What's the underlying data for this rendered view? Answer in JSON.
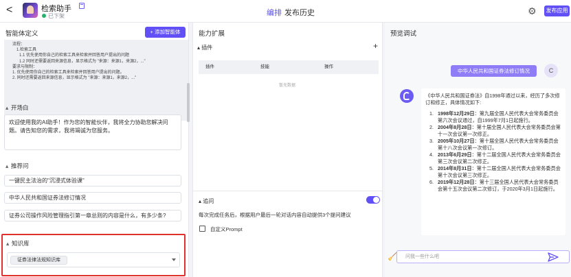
{
  "header": {
    "back_glyph": "<",
    "app_name": "检索助手",
    "status": "已下架",
    "tabs": [
      {
        "label": "编排"
      },
      {
        "label": "发布历史"
      }
    ],
    "publish_label": "发布应用"
  },
  "agent_panel": {
    "title": "智能体定义",
    "add_agent_label": "+ 添加智能体",
    "definition_lines": [
      "流程：",
      "  1.检索工具",
      "    1.1 优先使用你自己的检索工具来检索并回答用户提出的问题",
      "    1.2 同时还需要返回来源信息，显示格式为 \"来源：来源1，来源2，...\"",
      "要求与限制：",
      "  1. 优先使用你自己的检索工具来检索并回答用户提出的问题。",
      "  2. 同时还需要返回来源信息，显示格式为 \"来源：来源1，来源2，...\""
    ],
    "opening": {
      "title": "开场白",
      "text": "欢迎使用我的AI助手！作为您的智能伙伴，我将全力协助您解决问题。请告知您的需求，我将竭诚为您服务。"
    },
    "suggested": {
      "title": "推荐问",
      "items": [
        "一键民主法治的\"沉浸式体验课\"",
        "中华人民共和国证券法修订情况",
        "证券公司操作风险管理指引第一章总则的内容是什么，有多少条?"
      ]
    },
    "knowledge": {
      "title": "知识库",
      "tag": "证券法律法规知识库"
    }
  },
  "ability_panel": {
    "title": "能力扩展",
    "plugin": {
      "title": "插件",
      "add_glyph": "+",
      "columns": [
        "插件",
        "技能",
        "操作"
      ],
      "empty": "暂无数据"
    },
    "followup": {
      "title": "追问",
      "enabled": true,
      "desc": "每次完成任务后，根据用户最后一轮对话内容自动提供3个提问建议",
      "custom_prompt_label": "自定义Prompt"
    }
  },
  "preview_panel": {
    "title": "预览调试",
    "user_message": "中华人民共和国证券法修订情况",
    "user_avatar": "C",
    "bot_intro": "《中华人民共和国证券法》自1998年通过以来，经历了多次修订和修正，具体情况如下:",
    "bot_items": [
      {
        "num": "1.",
        "date": "1998年12月29日",
        "text": "：第九届全国人民代表大会常务委员会第六次会议通过，自1999年7月1日起施行。"
      },
      {
        "num": "2.",
        "date": "2004年8月28日",
        "text": "：第十届全国人民代表大会常务委员会第十一次会议第一次修正。"
      },
      {
        "num": "3.",
        "date": "2005年10月27日",
        "text": "：第十届全国人民代表大会常务委员会第十八次会议第一次修订。"
      },
      {
        "num": "4.",
        "date": "2013年6月29日",
        "text": "：第十二届全国人民代表大会常务委员会第三次会议第二次修正。"
      },
      {
        "num": "5.",
        "date": "2014年8月31日",
        "text": "：第十二届全国人民代表大会常务委员会第十次会议第三次修正。"
      },
      {
        "num": "6.",
        "date": "2019年12月28日",
        "text": "：第十三届全国人民代表大会常务委员会第十五次会议第二次修订，于2020年3月1日起施行。"
      }
    ],
    "input_placeholder": "问我一些什么吧"
  },
  "colors": {
    "accent": "#6150f5",
    "highlight_border": "#e0302b",
    "user_bubble": "#8f7cf7"
  }
}
